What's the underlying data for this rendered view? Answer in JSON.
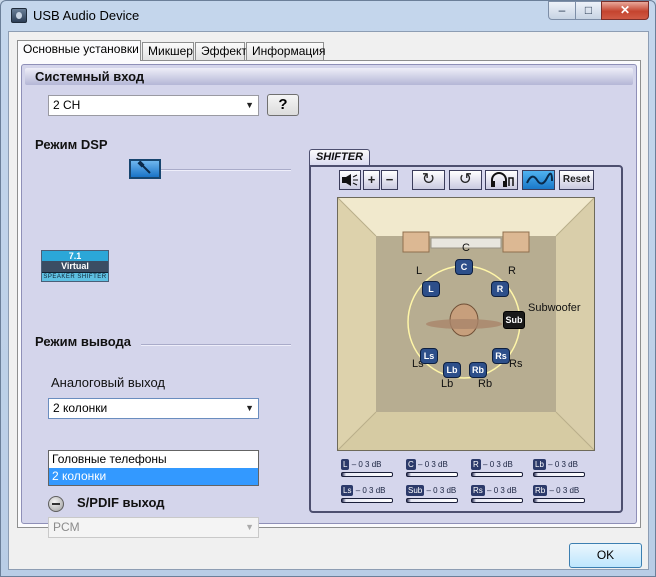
{
  "window": {
    "title": "USB Audio Device"
  },
  "titlebar_buttons": {
    "min": "–",
    "max": "□",
    "close": "✕"
  },
  "tabs": [
    {
      "label": "Основные установки",
      "active": true
    },
    {
      "label": "Микшер"
    },
    {
      "label": "Эффект"
    },
    {
      "label": "Информация"
    }
  ],
  "system_input": {
    "label": "Системный вход",
    "value": "2 CH",
    "help_label": "?"
  },
  "dsp": {
    "label": "Режим DSP"
  },
  "badge": {
    "line1": "7.1",
    "line2": "Virtual",
    "line3": "SPEAKER SHIFTER"
  },
  "output": {
    "label": "Режим вывода",
    "analog_label": "Аналоговый выход",
    "analog_value": "2 колонки",
    "options": [
      "Головные телефоны",
      "2 колонки"
    ],
    "selected_index": 1,
    "spdif_label": "S/PDIF выход",
    "spdif_value": "PCM"
  },
  "shifter": {
    "tab_label": "SHIFTER",
    "toolbar": {
      "plus": "+",
      "minus": "−",
      "rotate_cw": "↻",
      "rotate_ccw": "↺",
      "reset": "Reset"
    },
    "speakers": {
      "L": "L",
      "C": "C",
      "R": "R",
      "Ls": "Ls",
      "Rs": "Rs",
      "Lb": "Lb",
      "Rb": "Rb",
      "Sub": "Sub",
      "Subwoofer": "Subwoofer"
    },
    "meters": [
      {
        "tag": "L",
        "value": "– 0 3 dB"
      },
      {
        "tag": "C",
        "value": "– 0 3 dB"
      },
      {
        "tag": "R",
        "value": "– 0 3 dB"
      },
      {
        "tag": "Lb",
        "value": "– 0 3 dB"
      },
      {
        "tag": "Ls",
        "value": "– 0 3 dB"
      },
      {
        "tag": "Sub",
        "value": "– 0 3 dB"
      },
      {
        "tag": "Rs",
        "value": "– 0 3 dB"
      },
      {
        "tag": "Rb",
        "value": "– 0 3 dB"
      }
    ]
  },
  "ok_label": "OK"
}
